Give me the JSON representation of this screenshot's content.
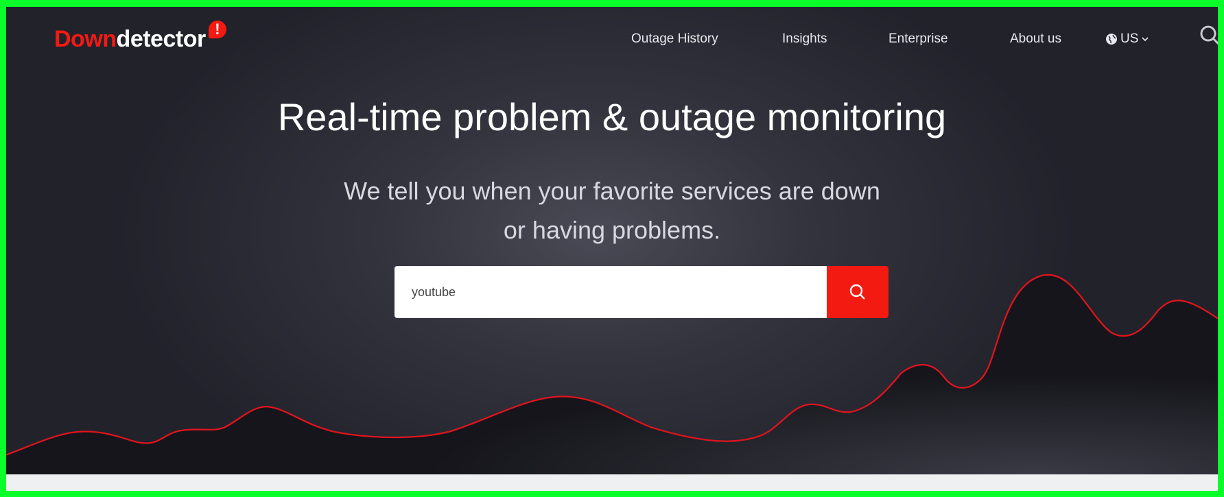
{
  "header": {
    "logo": {
      "part1": "Down",
      "part2": "detector",
      "mark": "!"
    },
    "nav": [
      {
        "label": "Outage History"
      },
      {
        "label": "Insights"
      },
      {
        "label": "Enterprise"
      },
      {
        "label": "About us"
      }
    ],
    "region": {
      "label": "US",
      "icon": "globe-icon"
    },
    "search_icon": "search-icon"
  },
  "hero": {
    "title": "Real-time problem & outage monitoring",
    "subtitle_line1": "We tell you when your favorite services are down",
    "subtitle_line2": "or having problems.",
    "search": {
      "value": "youtube"
    }
  },
  "colors": {
    "brand": "#f31a12",
    "background": "#2b2b34",
    "wave_line": "#e0141e"
  }
}
